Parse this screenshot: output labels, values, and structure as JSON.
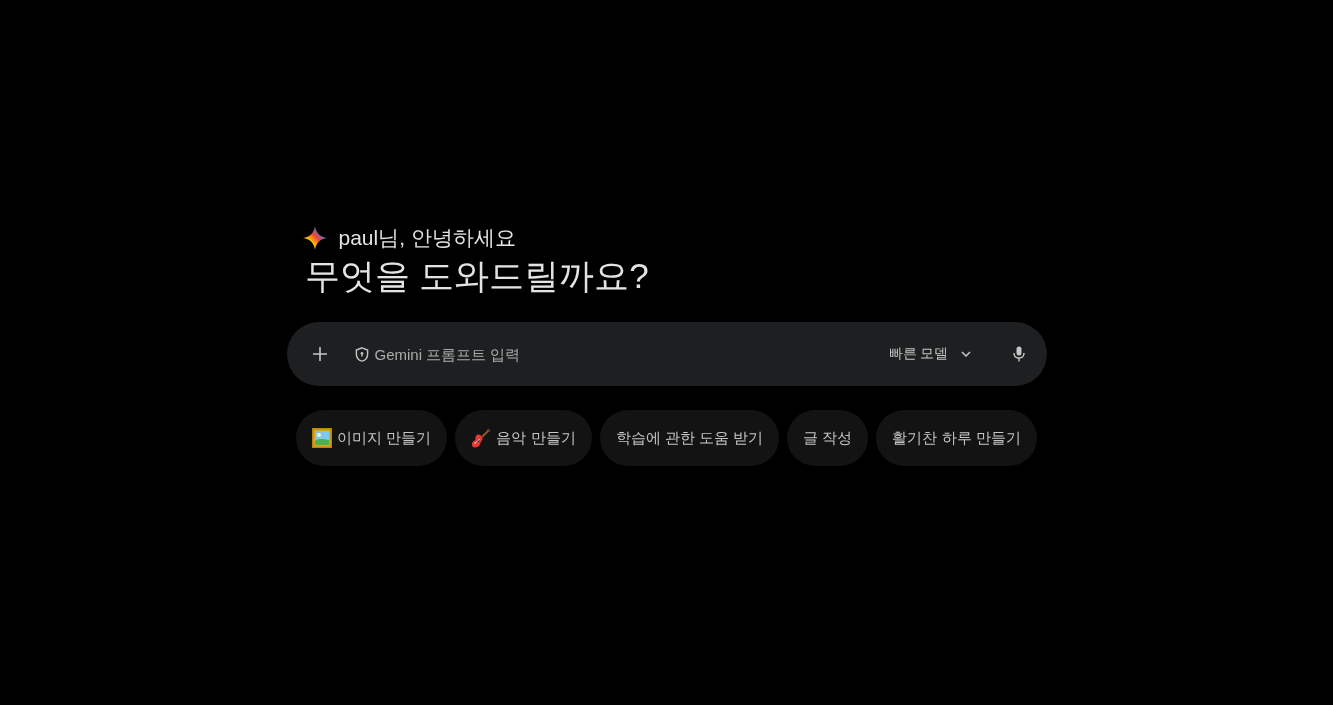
{
  "greeting": {
    "text": "paul님, 안녕하세요"
  },
  "headline": "무엇을 도와드릴까요?",
  "prompt_bar": {
    "placeholder": "Gemini 프롬프트 입력",
    "model_selector": {
      "label": "빠른 모델"
    }
  },
  "suggestions": [
    {
      "kind": "image",
      "label": "이미지 만들기"
    },
    {
      "kind": "music",
      "label": "음악 만들기"
    },
    {
      "kind": "plain",
      "label": "학습에 관한 도움 받기"
    },
    {
      "kind": "plain",
      "label": "글 작성"
    },
    {
      "kind": "plain",
      "label": "활기찬 하루 만들기"
    }
  ]
}
